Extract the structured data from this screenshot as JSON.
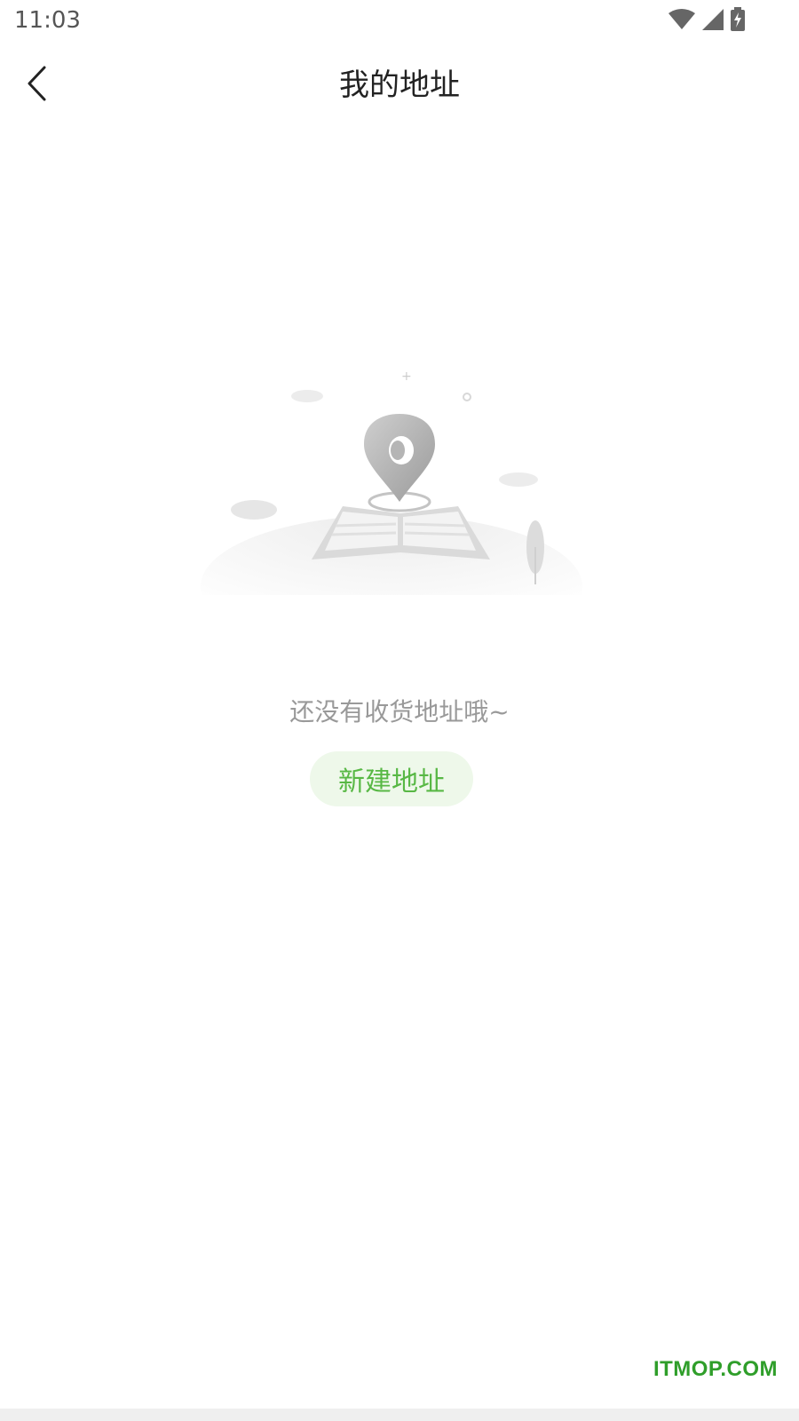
{
  "status_bar": {
    "time": "11:03",
    "icons": [
      "wifi-icon",
      "cellular-signal-icon",
      "battery-charging-icon"
    ]
  },
  "nav": {
    "back_icon": "chevron-left-icon",
    "title": "我的地址"
  },
  "empty_state": {
    "illustration": "map-pin-on-open-book",
    "message": "还没有收货地址哦~",
    "button_label": "新建地址"
  },
  "watermark": "ITMOP.COM",
  "colors": {
    "accent": "#58b845",
    "accent_bg": "#eef8ea",
    "muted_text": "#999999",
    "title_text": "#222222"
  }
}
